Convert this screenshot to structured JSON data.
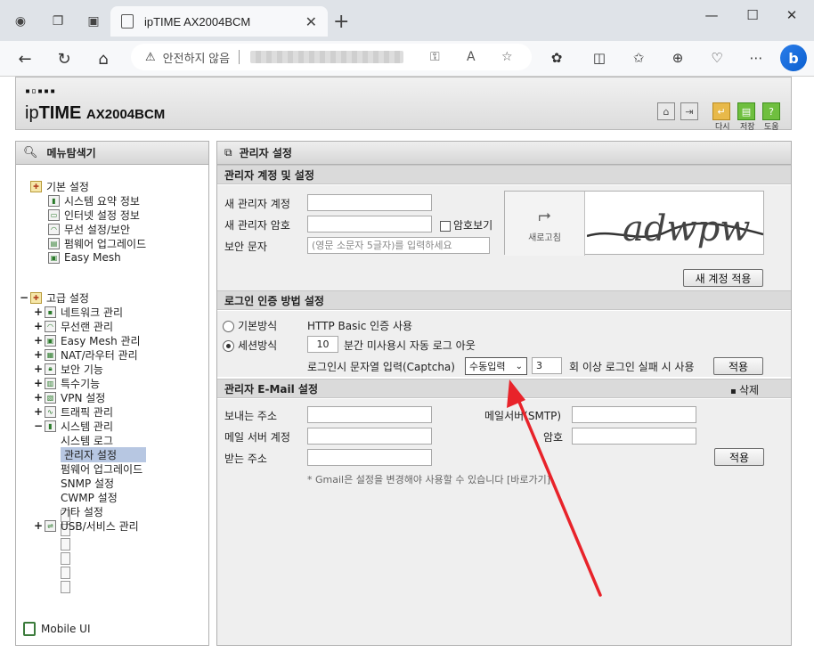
{
  "browser": {
    "tab_title": "ipTIME AX2004BCM",
    "security_text": "안전하지 않음"
  },
  "header": {
    "logo_dots": "▪▫▪▪▪",
    "logo_ip": "ip",
    "logo_time": "TIME",
    "logo_model": "AX2004BCM",
    "btn_restart": "다시",
    "btn_save": "저장",
    "btn_help": "도움"
  },
  "sidebar": {
    "title": "메뉴탐색기",
    "basic": {
      "label": "기본 설정",
      "items": [
        "시스템 요약 정보",
        "인터넷 설정 정보",
        "무선 설정/보안",
        "펌웨어 업그레이드",
        "Easy Mesh"
      ]
    },
    "advanced": {
      "label": "고급 설정",
      "items": [
        "네트워크 관리",
        "무선랜 관리",
        "Easy Mesh 관리",
        "NAT/라우터 관리",
        "보안 기능",
        "특수기능",
        "VPN 설정",
        "트래픽 관리",
        "시스템 관리"
      ],
      "system_items": [
        "시스템 로그",
        "관리자 설정",
        "펌웨어 업그레이드",
        "SNMP 설정",
        "CWMP 설정",
        "기타 설정"
      ],
      "last": "USB/서비스 관리"
    },
    "mobile_label": "Mobile UI"
  },
  "main": {
    "title": "관리자 설정",
    "account": {
      "section": "관리자 계정 및 설정",
      "new_id_label": "새 관리자 계정",
      "new_pw_label": "새 관리자 암호",
      "show_pw_label": "암호보기",
      "captcha_label": "보안 문자",
      "captcha_placeholder": "(영문 소문자 5글자)를 입력하세요",
      "refresh_label": "새로고침",
      "captcha_text": "adwpw",
      "apply_button": "새 계정 적용"
    },
    "login": {
      "section": "로그인 인증 방법 설정",
      "basic_label": "기본방식",
      "basic_desc": "HTTP Basic 인증 사용",
      "session_label": "세션방식",
      "session_minutes": "10",
      "session_desc": "분간 미사용시 자동 로그 아웃",
      "captcha_label": "로그인시 문자열 입력(Captcha)",
      "captcha_mode": "수동입력",
      "fail_count": "3",
      "fail_desc": "회 이상 로그인 실패 시 사용",
      "apply_button": "적용"
    },
    "email": {
      "section": "관리자 E-Mail 설정",
      "delete_label": "삭제",
      "sender_label": "보내는 주소",
      "smtp_label": "메일서버(SMTP)",
      "account_label": "메일 서버 계정",
      "password_label": "암호",
      "receiver_label": "받는 주소",
      "apply_button": "적용",
      "note": "* Gmail은 설정을 변경해야 사용할 수 있습니다 [바로가기]"
    }
  },
  "annotation": {
    "arrow_color": "#e8232a"
  }
}
